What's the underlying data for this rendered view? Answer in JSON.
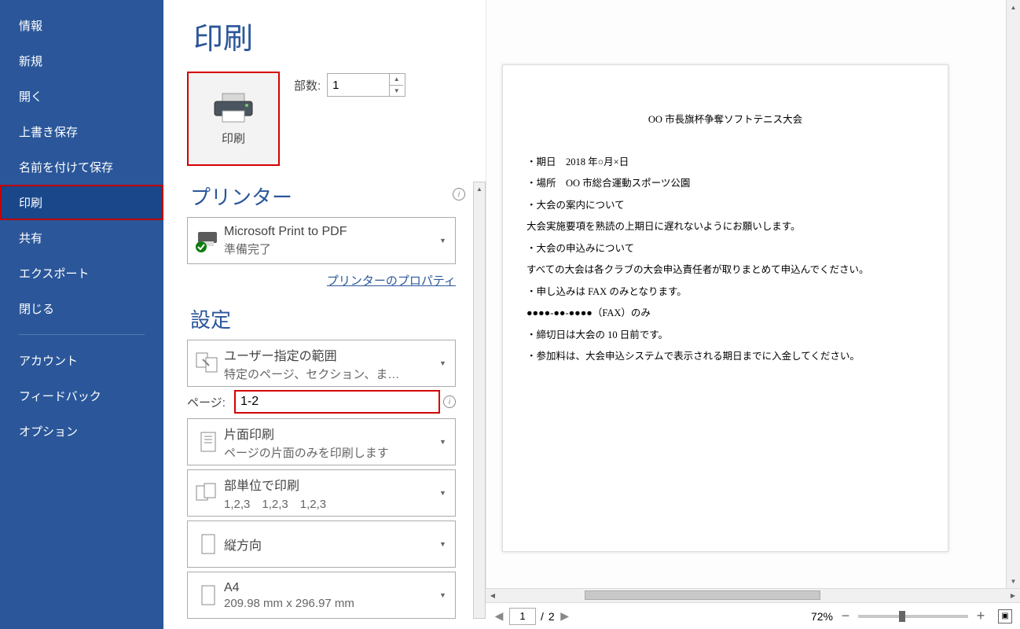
{
  "sidebar": {
    "items": [
      "情報",
      "新規",
      "開く",
      "上書き保存",
      "名前を付けて保存",
      "印刷",
      "共有",
      "エクスポート",
      "閉じる"
    ],
    "lower": [
      "アカウント",
      "フィードバック",
      "オプション"
    ],
    "active_index": 5
  },
  "title": "印刷",
  "print_button_label": "印刷",
  "copies": {
    "label": "部数:",
    "value": "1"
  },
  "printer": {
    "heading": "プリンター",
    "name": "Microsoft Print to PDF",
    "status": "準備完了",
    "properties_link": "プリンターのプロパティ"
  },
  "settings": {
    "heading": "設定",
    "range": {
      "line1": "ユーザー指定の範囲",
      "line2": "特定のページ、セクション、ま…"
    },
    "page_label": "ページ:",
    "page_value": "1-2",
    "options": [
      {
        "line1": "片面印刷",
        "line2": "ページの片面のみを印刷します",
        "icon": "single-side"
      },
      {
        "line1": "部単位で印刷",
        "line2": "1,2,3　1,2,3　1,2,3",
        "icon": "collate"
      },
      {
        "line1": "縦方向",
        "line2": "",
        "icon": "portrait"
      },
      {
        "line1": "A4",
        "line2": "209.98 mm x 296.97 mm",
        "icon": "paper"
      }
    ]
  },
  "preview": {
    "lines": [
      "OO 市長旗杯争奪ソフトテニス大会",
      "・期日　2018 年○月×日",
      "・場所　OO 市総合運動スポーツ公園",
      "・大会の案内について",
      "大会実施要項を熟読の上期日に遅れないようにお願いします。",
      "・大会の申込みについて",
      "すべての大会は各クラブの大会申込責任者が取りまとめて申込んでください。",
      "・申し込みは FAX のみとなります。",
      "●●●●-●●-●●●●（FAX）のみ",
      "・締切日は大会の 10 日前です。",
      "・参加料は、大会申込システムで表示される期日までに入金してください。"
    ],
    "page_current": "1",
    "page_total": "2",
    "page_sep": " /",
    "zoom": "72%"
  }
}
